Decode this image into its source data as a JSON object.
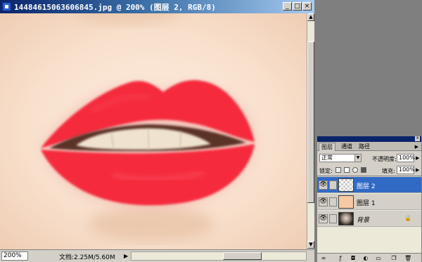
{
  "window": {
    "title": "14484615063606845.jpg @ 200% (图层 2, RGB/8)",
    "minimize": "_",
    "restore": "□",
    "close": "×"
  },
  "status": {
    "zoom": "200%",
    "doc_size": "文档:2.25M/5.60M",
    "arrow": "▶"
  },
  "scrollbar": {
    "up": "▲",
    "down": "▼",
    "left": "◀",
    "right": "▶"
  },
  "layers_panel": {
    "close": "x",
    "tabs": [
      "图层",
      "通道",
      "路径"
    ],
    "menu_arrow": "▶",
    "blend_mode": "正常",
    "opacity_label": "不透明度:",
    "opacity_value": "100%",
    "lock_label": "锁定:",
    "fill_label": "填充:",
    "fill_value": "100%",
    "layers": [
      {
        "name": "图层 2",
        "selected": true
      },
      {
        "name": "图层 1",
        "selected": false
      },
      {
        "name": "背景",
        "selected": false
      }
    ]
  },
  "colors": {
    "lip": "#f5283c",
    "skin": "#fbe9da",
    "selection": "#316ac5"
  }
}
